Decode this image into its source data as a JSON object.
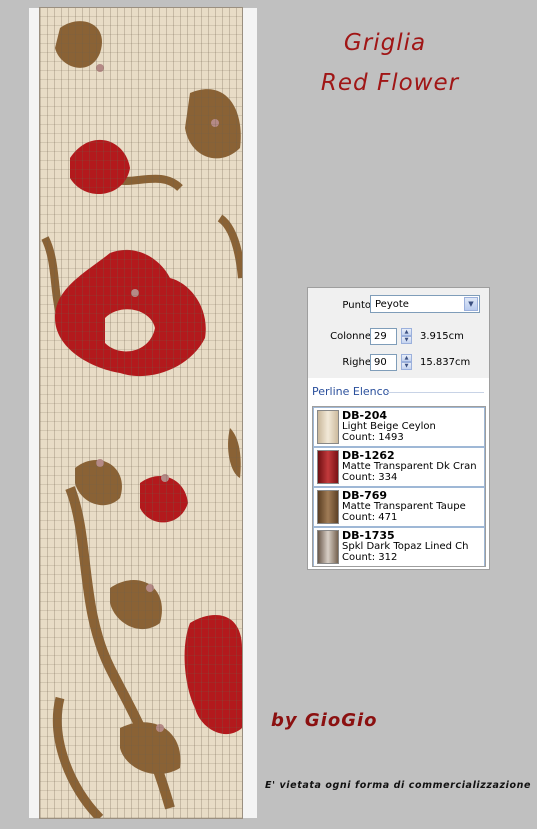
{
  "header": {
    "title_line1": "Griglia",
    "title_line2": "Red Flower"
  },
  "footer": {
    "author": "by GioGio",
    "notice": "E' vietata ogni forma di commercializzazione"
  },
  "pattern": {
    "colors": {
      "background_bead": "#e8dcc6",
      "red_bead": "#b3191c",
      "brown_bead": "#8a6235",
      "topaz_bead": "#b58a86"
    }
  },
  "settings": {
    "stitch_label": "Punto",
    "stitch_value": "Peyote",
    "columns_label": "Colonne",
    "columns_value": "29",
    "columns_measure": "3.915cm",
    "rows_label": "Righe",
    "rows_value": "90",
    "rows_measure": "15.837cm"
  },
  "bead_list": {
    "header": "Perline Elenco",
    "items": [
      {
        "code": "DB-204",
        "name": "Light Beige Ceylon",
        "count": "Count: 1493",
        "color": "#e6dac4"
      },
      {
        "code": "DB-1262",
        "name": "Matte Transparent Dk Cran",
        "count": "Count: 334",
        "color": "#9e1c1f"
      },
      {
        "code": "DB-769",
        "name": "Matte Transparent Taupe",
        "count": "Count: 471",
        "color": "#7d5a38"
      },
      {
        "code": "DB-1735",
        "name": "Spkl Dark Topaz Lined Ch",
        "count": "Count: 312",
        "color": "#9c8877"
      }
    ]
  }
}
